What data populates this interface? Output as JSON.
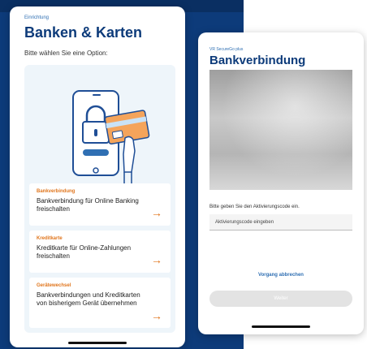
{
  "left_screen": {
    "eyebrow": "Einrichtung",
    "title": "Banken & Karten",
    "subtitle": "Bitte wählen Sie eine Option:",
    "options": [
      {
        "category": "Bankverbindung",
        "description": "Bankverbindung für Online Banking freischalten",
        "icon": "arrow-right-icon"
      },
      {
        "category": "Kreditkarte",
        "description": "Kreditkarte für Online-Zahlungen freischalten",
        "icon": "arrow-right-icon"
      },
      {
        "category": "Gerätewechsel",
        "description": "Bankverbindungen und Kreditkarten von bisherigem Gerät übernehmen",
        "icon": "arrow-right-icon"
      }
    ],
    "arrow_glyph": "→"
  },
  "right_screen": {
    "eyebrow": "VR SecureGo plus",
    "title": "Bankverbindung",
    "instruction": "Bitte geben Sie den Aktivierungscode ein.",
    "code_field": {
      "placeholder": "Aktivierungscode eingeben",
      "value": ""
    },
    "cancel_link": "Vorgang abbrechen",
    "next_button": "Weiter"
  },
  "colors": {
    "brand_navy": "#0d3b7a",
    "accent_orange": "#e0751c",
    "link_blue": "#2f6fb3",
    "panel_bg": "#eef5fa"
  }
}
